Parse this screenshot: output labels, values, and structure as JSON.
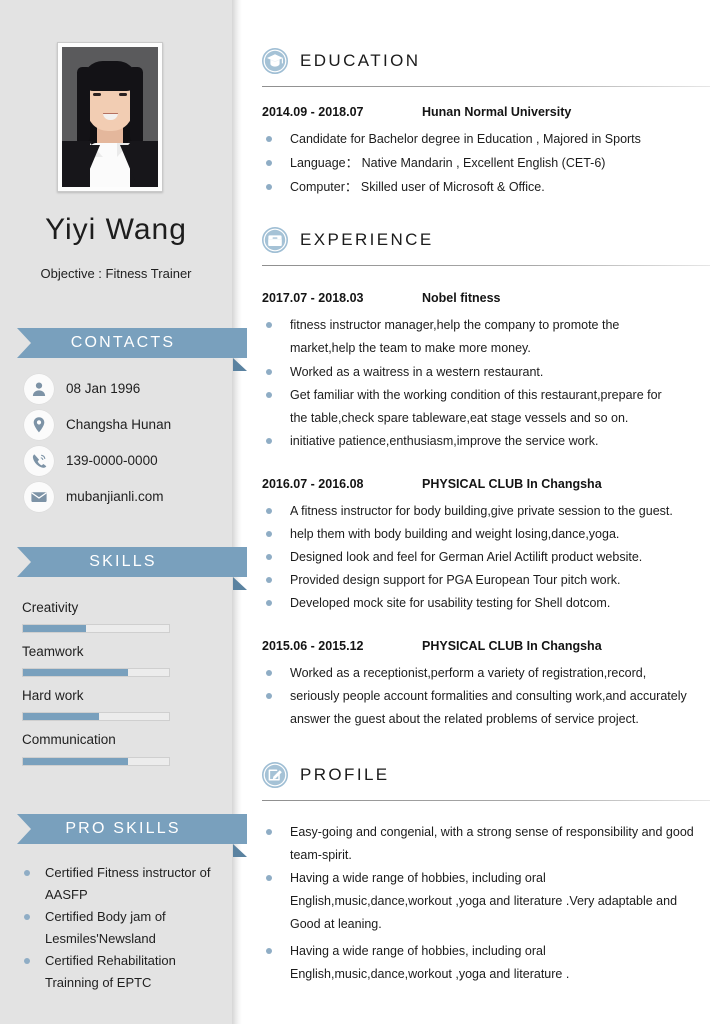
{
  "profile_card": {
    "name": "Yiyi Wang",
    "objective": "Objective : Fitness Trainer",
    "photo_alt": "portrait-photo"
  },
  "sidebar": {
    "contacts": {
      "banner": "CONTACTS",
      "items": [
        {
          "icon": "person-icon",
          "value": "08 Jan 1996"
        },
        {
          "icon": "location-pin-icon",
          "value": "Changsha Hunan"
        },
        {
          "icon": "phone-icon",
          "value": "139-0000-0000"
        },
        {
          "icon": "envelope-icon",
          "value": "mubanjianli.com"
        }
      ]
    },
    "skills": {
      "banner": "SKILLS",
      "items": [
        {
          "label": "Creativity",
          "percent": 43
        },
        {
          "label": "Teamwork",
          "percent": 72
        },
        {
          "label": "Hard work",
          "percent": 52
        },
        {
          "label": "Communication",
          "percent": 72
        }
      ]
    },
    "pro_skills": {
      "banner": "PRO SKILLS",
      "items": [
        "Certified Fitness instructor of AASFP",
        "Certified Body jam of Lesmiles'Newsland",
        "Certified Rehabilitation Trainning of EPTC"
      ]
    }
  },
  "main": {
    "education": {
      "title": "EDUCATION",
      "icon": "graduation-cap-icon",
      "entries": [
        {
          "dates": "2014.09 - 2018.07",
          "org": "Hunan Normal University",
          "bullets": [
            "Candidate for Bachelor degree in Education , Majored in Sports",
            "Language： Native Mandarin , Excellent English (CET-6)",
            "Computer： Skilled user of Microsoft & Office."
          ]
        }
      ]
    },
    "experience": {
      "title": "EXPERIENCE",
      "icon": "briefcase-icon",
      "entries": [
        {
          "dates": "2017.07 - 2018.03",
          "org": "Nobel fitness",
          "bullets": [
            "fitness instructor manager,help the company to promote the",
            "market,help the team to make more money.",
            "Worked as a waitress in a western restaurant.",
            "Get familiar with the working condition of this restaurant,prepare for",
            "the table,check spare tableware,eat stage vessels and so on.",
            "initiative patience,enthusiasm,improve the service work."
          ],
          "bullet_flags": [
            true,
            false,
            true,
            true,
            false,
            true
          ]
        },
        {
          "dates": "2016.07 - 2016.08",
          "org": "PHYSICAL CLUB In Changsha",
          "bullets": [
            "A fitness instructor for body building,give private session to the guest.",
            "help them with body building and weight losing,dance,yoga.",
            "Designed look and feel for German Ariel Actilift product website.",
            "Provided design support for PGA European Tour pitch work.",
            "Developed mock site for usability testing for Shell dotcom."
          ],
          "bullet_flags": [
            true,
            true,
            true,
            true,
            true
          ]
        },
        {
          "dates": "2015.06 - 2015.12",
          "org": "PHYSICAL CLUB In Changsha",
          "bullets": [
            "Worked as a receptionist,perform a variety of registration,record,",
            "seriously people account formalities and consulting work,and accurately",
            "answer the guest about the related problems of service project."
          ],
          "bullet_flags": [
            true,
            true,
            false
          ]
        }
      ]
    },
    "profile": {
      "title": "PROFILE",
      "icon": "pencil-edit-icon",
      "bullets": [
        "Easy-going and congenial, with a strong sense of responsibility and good",
        "team-spirit.",
        "Having a wide range of hobbies, including oral",
        "English,music,dance,workout ,yoga and literature .Very adaptable and",
        "Good at leaning.",
        "Having a wide range of hobbies, including oral",
        "English,music,dance,workout ,yoga and literature ."
      ],
      "bullet_flags": [
        true,
        false,
        true,
        false,
        false,
        true,
        false
      ]
    }
  },
  "colors": {
    "accent": "#79a0bd",
    "accent_dark": "#5a82a0",
    "bullet": "#8fadc5",
    "sidebar_bg": "#e3e3e3",
    "text": "#1c1c1c"
  }
}
